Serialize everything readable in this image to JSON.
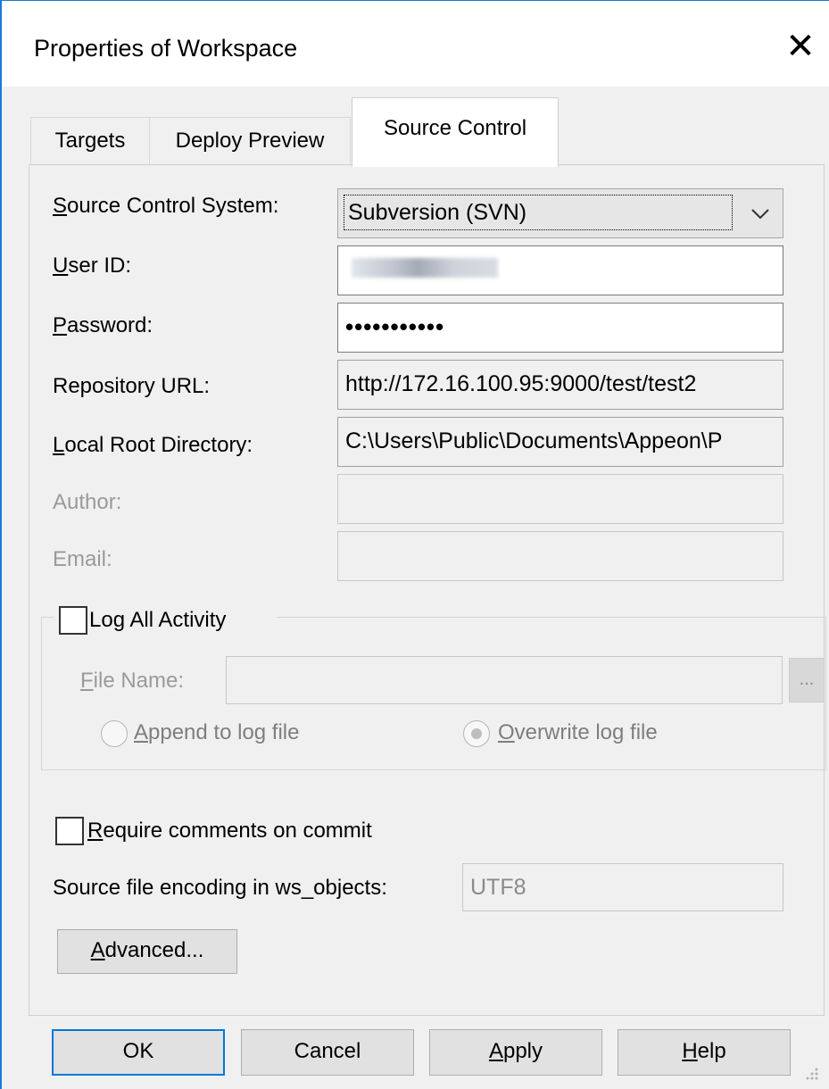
{
  "window": {
    "title": "Properties of Workspace",
    "close_glyph": "✕"
  },
  "tabs": [
    {
      "label": "Targets",
      "active": false
    },
    {
      "label": "Deploy Preview",
      "active": false
    },
    {
      "label": "Source Control",
      "active": true
    }
  ],
  "form": {
    "source_control_system": {
      "label_u": "S",
      "label_rest": "ource Control System:",
      "value": "Subversion (SVN)"
    },
    "user_id": {
      "label_u": "U",
      "label_rest": "ser ID:",
      "value_redacted": true
    },
    "password": {
      "label_u": "P",
      "label_rest": "assword:",
      "value": "•••••••••••"
    },
    "repository_url": {
      "label": "Repository URL:",
      "value": "http://172.16.100.95:9000/test/test2"
    },
    "local_root": {
      "label_u": "L",
      "label_rest": "ocal Root Directory:",
      "value": "C:\\Users\\Public\\Documents\\Appeon\\P"
    },
    "author": {
      "label": "Author:",
      "value": ""
    },
    "email": {
      "label": "Email:",
      "value": ""
    }
  },
  "log": {
    "checkbox_pre": "Lo",
    "checkbox_u": "g",
    "checkbox_post": " All Activity",
    "checked": false,
    "file_name_u": "F",
    "file_name_rest": "ile Name:",
    "file_name_value": "",
    "browse_label": "...",
    "append_u": "A",
    "append_rest": "ppend to log file",
    "overwrite_u": "O",
    "overwrite_rest": "verwrite log file",
    "selected": "overwrite"
  },
  "require_comments": {
    "label_u": "R",
    "label_rest": "equire comments on commit",
    "checked": false
  },
  "encoding": {
    "label": "Source file encoding in ws_objects:",
    "value": "UTF8"
  },
  "advanced": {
    "label_u": "A",
    "label_rest": "dvanced..."
  },
  "buttons": {
    "ok": "OK",
    "cancel": "Cancel",
    "apply_u": "A",
    "apply_rest": "pply",
    "help_u": "H",
    "help_rest": "elp"
  },
  "colors": {
    "accent": "#0078d7",
    "window_border": "#1a7ad6",
    "dialog_bg": "#f0f0f0",
    "disabled_text": "#9a9a9a"
  }
}
